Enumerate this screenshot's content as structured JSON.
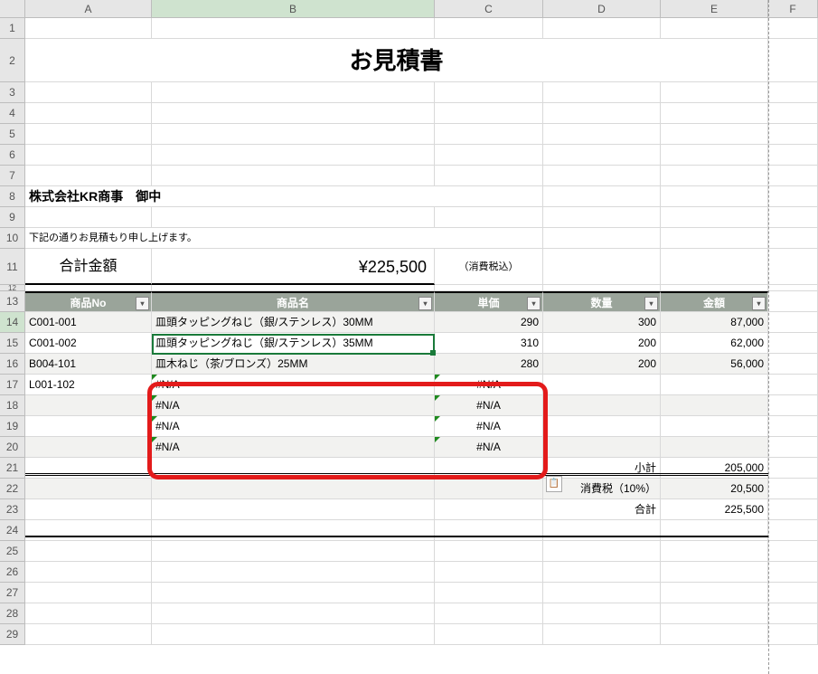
{
  "columns": [
    "A",
    "B",
    "C",
    "D",
    "E",
    "F"
  ],
  "row_numbers": [
    1,
    2,
    3,
    4,
    5,
    6,
    7,
    8,
    9,
    10,
    11,
    12,
    13,
    14,
    15,
    16,
    17,
    18,
    19,
    20,
    21,
    22,
    23,
    24,
    25,
    26,
    27,
    28,
    29
  ],
  "title": "お見積書",
  "company": "株式会社KR商事　御中",
  "memo": "下記の通りお見積もり申し上げます。",
  "total_label": "合計金額",
  "total_amount": "¥225,500",
  "tax_note": "（消費税込）",
  "headers": {
    "a": "商品No",
    "b": "商品名",
    "c": "単価",
    "d": "数量",
    "e": "金額"
  },
  "rows": [
    {
      "no": "C001-001",
      "name": "皿頭タッピングねじ（銀/ステンレス）30MM",
      "price": "290",
      "qty": "300",
      "amt": "87,000"
    },
    {
      "no": "C001-002",
      "name": "皿頭タッピングねじ（銀/ステンレス）35MM",
      "price": "310",
      "qty": "200",
      "amt": "62,000"
    },
    {
      "no": "B004-101",
      "name": "皿木ねじ（茶/ブロンズ）25MM",
      "price": "280",
      "qty": "200",
      "amt": "56,000"
    },
    {
      "no": "L001-102",
      "name": "#N/A",
      "price": "#N/A",
      "qty": "",
      "amt": ""
    },
    {
      "no": "",
      "name": "#N/A",
      "price": "#N/A",
      "qty": "",
      "amt": ""
    },
    {
      "no": "",
      "name": "#N/A",
      "price": "#N/A",
      "qty": "",
      "amt": ""
    },
    {
      "no": "",
      "name": "#N/A",
      "price": "#N/A",
      "qty": "",
      "amt": ""
    }
  ],
  "footer": {
    "subtotal_label": "小計",
    "subtotal": "205,000",
    "tax_label": "消費税（10%）",
    "tax": "20,500",
    "total_label": "合計",
    "total": "225,500"
  },
  "chart_data": {
    "type": "table",
    "title": "お見積書",
    "headers": [
      "商品No",
      "商品名",
      "単価",
      "数量",
      "金額"
    ],
    "rows": [
      [
        "C001-001",
        "皿頭タッピングねじ（銀/ステンレス）30MM",
        290,
        300,
        87000
      ],
      [
        "C001-002",
        "皿頭タッピングねじ（銀/ステンレス）35MM",
        310,
        200,
        62000
      ],
      [
        "B004-101",
        "皿木ねじ（茶/ブロンズ）25MM",
        280,
        200,
        56000
      ],
      [
        "L001-102",
        "#N/A",
        "#N/A",
        null,
        null
      ]
    ],
    "totals": {
      "小計": 205000,
      "消費税（10%）": 20500,
      "合計": 225500
    }
  }
}
